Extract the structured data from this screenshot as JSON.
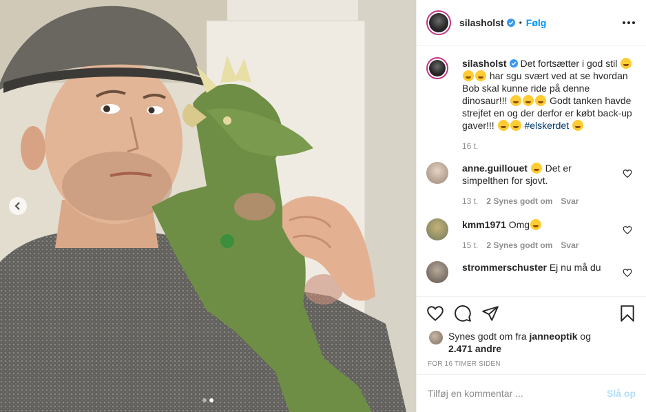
{
  "post": {
    "username": "silasholst",
    "follow_label": "Følg",
    "separator": "•"
  },
  "caption": {
    "username": "silasholst",
    "part1": " Det fortsætter i god stil ",
    "part2": " har sgu svært ved at se hvordan Bob skal kunne ride på denne dinosaur!!! ",
    "part3": " Godt tanken havde strejfet en og der derfor er købt back-up gaver!!! ",
    "hashtag": "#elskerdet",
    "time": "16 t."
  },
  "comments": [
    {
      "username": "anne.guillouet",
      "text": " Det er simpelthen for sjovt.",
      "time": "13 t.",
      "likes": "2 Synes godt om",
      "reply": "Svar"
    },
    {
      "username": "kmm1971",
      "text": " Omg",
      "time": "15 t.",
      "likes": "2 Synes godt om",
      "reply": "Svar"
    },
    {
      "username": "strommerschuster",
      "text": " Ej nu må du"
    }
  ],
  "likes": {
    "prefix": "Synes godt om fra ",
    "user": "janneoptik",
    "middle": " og",
    "count": "2.471 andre"
  },
  "timeago": "FOR 16 TIMER SIDEN",
  "add_comment": {
    "placeholder": "Tilføj en kommentar ...",
    "post_label": "Slå op"
  },
  "carousel": {
    "count": 2,
    "active": 1
  },
  "colors": {
    "accent": "#0095f6",
    "verified": "#3897f0",
    "story_ring": "#c13584"
  },
  "icons": [
    "chevron-left-icon",
    "more-icon",
    "verified-icon",
    "heart-icon",
    "comment-icon",
    "share-icon",
    "bookmark-icon"
  ]
}
